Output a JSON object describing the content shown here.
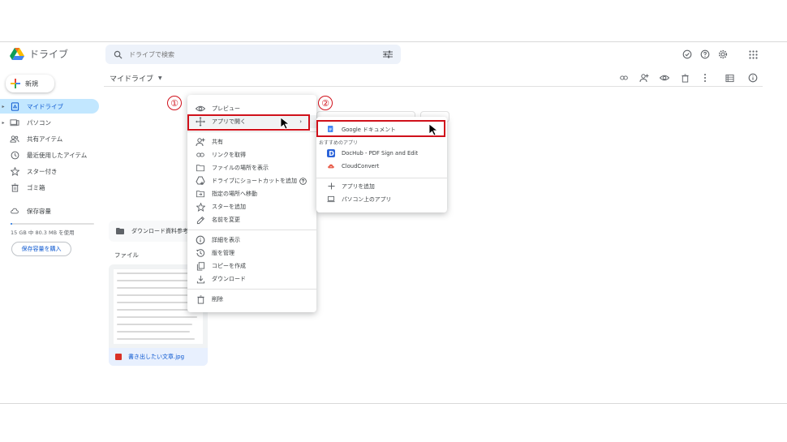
{
  "app": {
    "title": "ドライブ"
  },
  "search": {
    "placeholder": "ドライブで検索"
  },
  "sidebar": {
    "new_label": "新規",
    "items": [
      {
        "label": "マイドライブ",
        "icon": "drive-icon",
        "active": true
      },
      {
        "label": "パソコン",
        "icon": "computer-icon"
      },
      {
        "label": "共有アイテム",
        "icon": "people-icon"
      },
      {
        "label": "最近使用したアイテム",
        "icon": "clock-icon"
      },
      {
        "label": "スター付き",
        "icon": "star-icon"
      },
      {
        "label": "ゴミ箱",
        "icon": "trash-icon"
      }
    ],
    "storage_label": "保存容量",
    "storage_usage": "15 GB 中 80.3 MB を使用",
    "storage_fraction": 0.01,
    "buy_label": "保存容量を購入"
  },
  "breadcrumb": {
    "title": "マイドライブ"
  },
  "content": {
    "folder_name": "ダウンロード資料参考",
    "files_label": "ファイル",
    "file_name": "書き出したい文章.jpg"
  },
  "context_menu": {
    "items": [
      {
        "label": "プレビュー",
        "icon": "eye-icon"
      },
      {
        "label": "アプリで開く",
        "icon": "open-with-icon",
        "submenu": true
      },
      {
        "label": "共有",
        "icon": "person-add-icon"
      },
      {
        "label": "リンクを取得",
        "icon": "link-icon"
      },
      {
        "label": "ファイルの場所を表示",
        "icon": "folder-icon"
      },
      {
        "label": "ドライブにショートカットを追加",
        "icon": "shortcut-icon",
        "help": true
      },
      {
        "label": "指定の場所へ移動",
        "icon": "move-icon"
      },
      {
        "label": "スターを追加",
        "icon": "star-icon"
      },
      {
        "label": "名前を変更",
        "icon": "pencil-icon"
      },
      {
        "label": "詳細を表示",
        "icon": "info-icon"
      },
      {
        "label": "版を管理",
        "icon": "history-icon"
      },
      {
        "label": "コピーを作成",
        "icon": "copy-icon"
      },
      {
        "label": "ダウンロード",
        "icon": "download-icon"
      },
      {
        "label": "削除",
        "icon": "trash-icon"
      }
    ]
  },
  "sub_menu": {
    "primary": {
      "label": "Google ドキュメント",
      "icon": "docs-icon"
    },
    "section_label": "おすすめのアプリ",
    "apps": [
      {
        "label": "DocHub - PDF Sign and Edit",
        "icon": "dochub-icon"
      },
      {
        "label": "CloudConvert",
        "icon": "cloudconvert-icon"
      }
    ],
    "extras": [
      {
        "label": "アプリを追加",
        "icon": "plus-icon"
      },
      {
        "label": "パソコン上のアプリ",
        "icon": "laptop-icon"
      }
    ]
  },
  "annotations": {
    "step1": "①",
    "step2": "②"
  },
  "colors": {
    "accent": "#0b57d0",
    "active_bg": "#c2e7ff",
    "highlight": "#d0111b"
  }
}
